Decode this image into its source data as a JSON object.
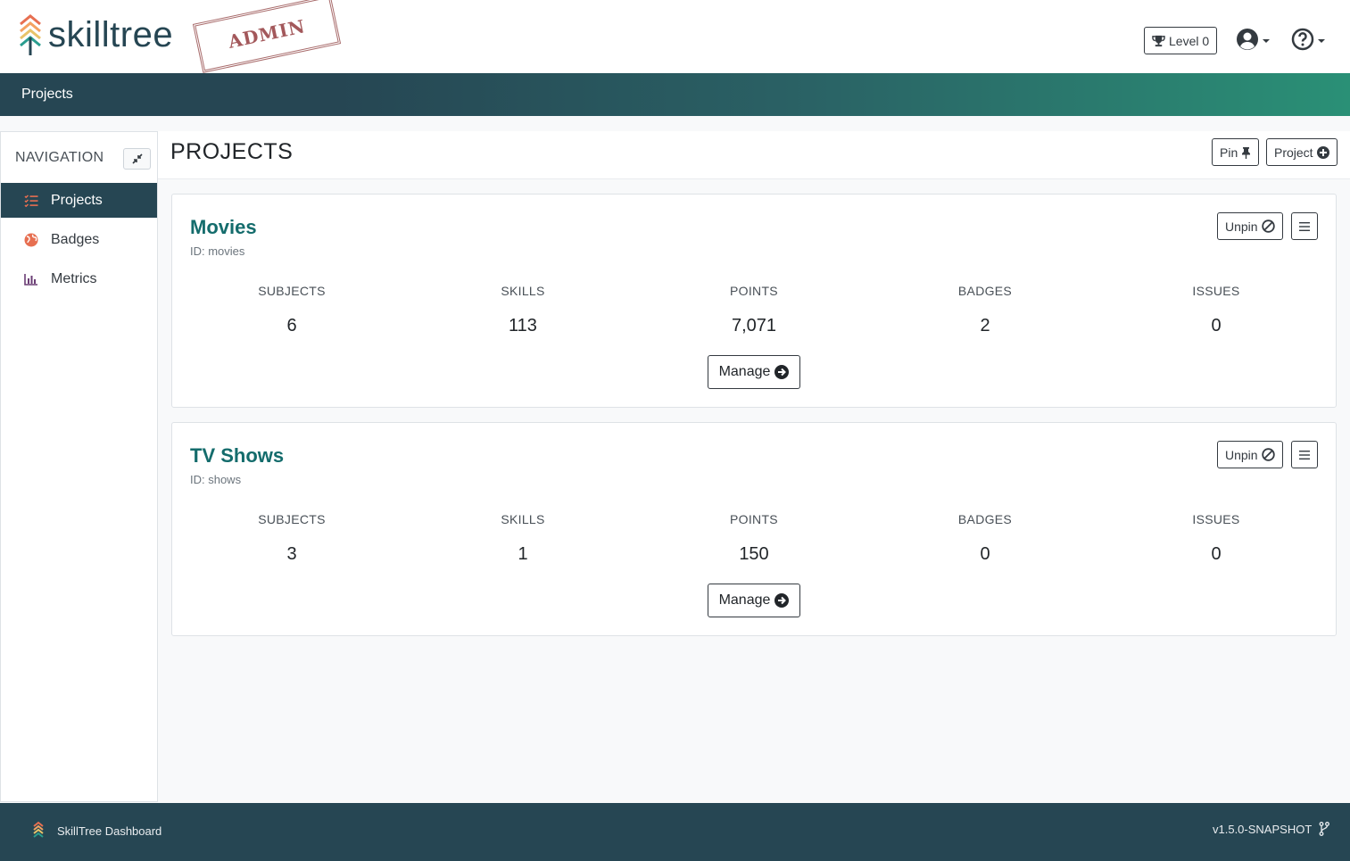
{
  "header": {
    "logo_text": "skilltree",
    "stamp_text": "ADMIN",
    "level_label": "Level 0"
  },
  "breadcrumb": {
    "current": "Projects"
  },
  "sidebar": {
    "title": "NAVIGATION",
    "items": [
      {
        "label": "Projects",
        "icon": "tasks-icon",
        "active": true
      },
      {
        "label": "Badges",
        "icon": "globe-icon",
        "active": false
      },
      {
        "label": "Metrics",
        "icon": "chart-bar-icon",
        "active": false
      }
    ]
  },
  "main": {
    "title": "PROJECTS",
    "pin_label": "Pin",
    "new_project_label": "Project"
  },
  "projects": [
    {
      "name": "Movies",
      "id_label": "ID: movies",
      "unpin_label": "Unpin",
      "manage_label": "Manage",
      "stats": [
        {
          "label": "SUBJECTS",
          "value": "6"
        },
        {
          "label": "SKILLS",
          "value": "113"
        },
        {
          "label": "POINTS",
          "value": "7,071"
        },
        {
          "label": "BADGES",
          "value": "2"
        },
        {
          "label": "ISSUES",
          "value": "0"
        }
      ]
    },
    {
      "name": "TV Shows",
      "id_label": "ID: shows",
      "unpin_label": "Unpin",
      "manage_label": "Manage",
      "stats": [
        {
          "label": "SUBJECTS",
          "value": "3"
        },
        {
          "label": "SKILLS",
          "value": "1"
        },
        {
          "label": "POINTS",
          "value": "150"
        },
        {
          "label": "BADGES",
          "value": "0"
        },
        {
          "label": "ISSUES",
          "value": "0"
        }
      ]
    }
  ],
  "footer": {
    "app_name": "SkillTree Dashboard",
    "version": "v1.5.0-SNAPSHOT"
  },
  "colors": {
    "brand_dark": "#264653",
    "brand_teal": "#2a9076",
    "title_teal": "#146c6c"
  }
}
